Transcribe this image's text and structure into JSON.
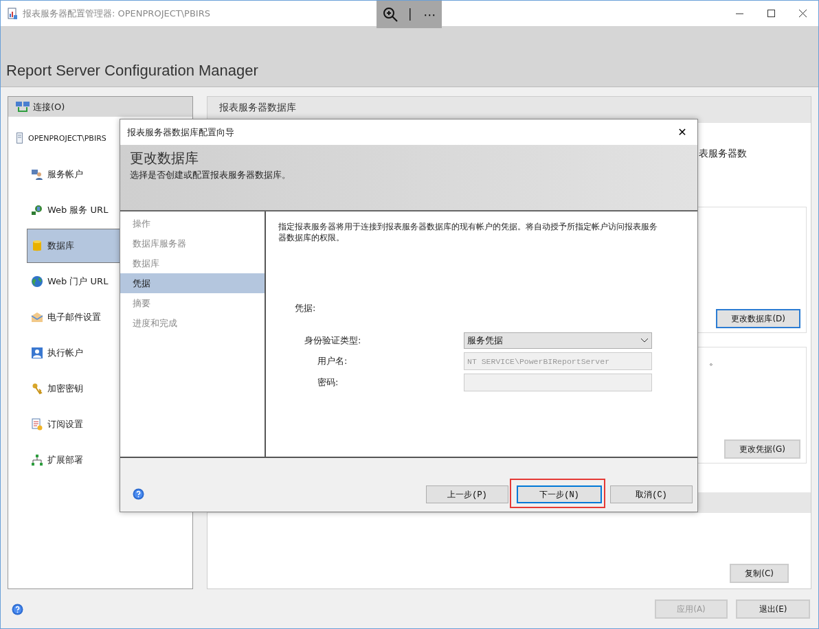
{
  "window": {
    "title": "报表服务器配置管理器: OPENPROJECT\\PBIRS",
    "toolbar": [
      "⋯"
    ]
  },
  "banner": {
    "title": "Report Server Configuration Manager"
  },
  "connect": {
    "label": "连接(O)",
    "server": "OPENPROJECT\\PBIRS"
  },
  "nav": [
    {
      "label": "服务帐户",
      "kind": "account",
      "selected": false
    },
    {
      "label": "Web 服务 URL",
      "kind": "web",
      "selected": false
    },
    {
      "label": "数据库",
      "kind": "database",
      "selected": true
    },
    {
      "label": "Web 门户 URL",
      "kind": "globe",
      "selected": false
    },
    {
      "label": "电子邮件设置",
      "kind": "mail",
      "selected": false
    },
    {
      "label": "执行帐户",
      "kind": "user",
      "selected": false
    },
    {
      "label": "加密密钥",
      "kind": "key",
      "selected": false
    },
    {
      "label": "订阅设置",
      "kind": "subscription",
      "selected": false
    },
    {
      "label": "扩展部署",
      "kind": "deploy",
      "selected": false
    }
  ],
  "panel": {
    "title": "报表服务器数据库",
    "fragment_1": "表服务器数",
    "fragment_2": "。",
    "buttons": [
      {
        "label": "更改数据库(D)",
        "default": true
      },
      {
        "label": "更改凭据(G)",
        "default": false
      },
      {
        "label": "复制(C)",
        "default": false
      }
    ]
  },
  "footer": {
    "buttons": [
      {
        "label": "应用(A)",
        "disabled": true
      },
      {
        "label": "退出(E)",
        "disabled": false
      }
    ]
  },
  "dialog": {
    "title": "报表服务器数据库配置向导",
    "close": "✕",
    "heading": "更改数据库",
    "subheading": "选择是否创建或配置报表服务器数据库。",
    "steps": [
      {
        "label": "操作",
        "selected": false
      },
      {
        "label": "数据库服务器",
        "selected": false
      },
      {
        "label": "数据库",
        "selected": false
      },
      {
        "label": "凭据",
        "selected": true
      },
      {
        "label": "摘要",
        "selected": false
      },
      {
        "label": "进度和完成",
        "selected": false
      }
    ],
    "description": "指定报表服务器将用于连接到报表服务器数据库的现有帐户的凭据。将自动授予所指定帐户访问报表服务器数据库的权限。",
    "section": "凭据:",
    "fields": [
      {
        "label": "身份验证类型:",
        "kind": "dropdown",
        "value": "服务凭据",
        "disabled": false
      },
      {
        "label": "用户名:",
        "kind": "text",
        "value": "NT SERVICE\\PowerBIReportServer",
        "disabled": true
      },
      {
        "label": "密码:",
        "kind": "text",
        "disabled": true
      }
    ],
    "buttons": [
      {
        "label": "上一步(P)",
        "focused": false,
        "highlighted": false
      },
      {
        "label": "下一步(N)",
        "focused": true,
        "highlighted": true
      },
      {
        "label": "取消(C)",
        "focused": false,
        "highlighted": false
      }
    ]
  }
}
